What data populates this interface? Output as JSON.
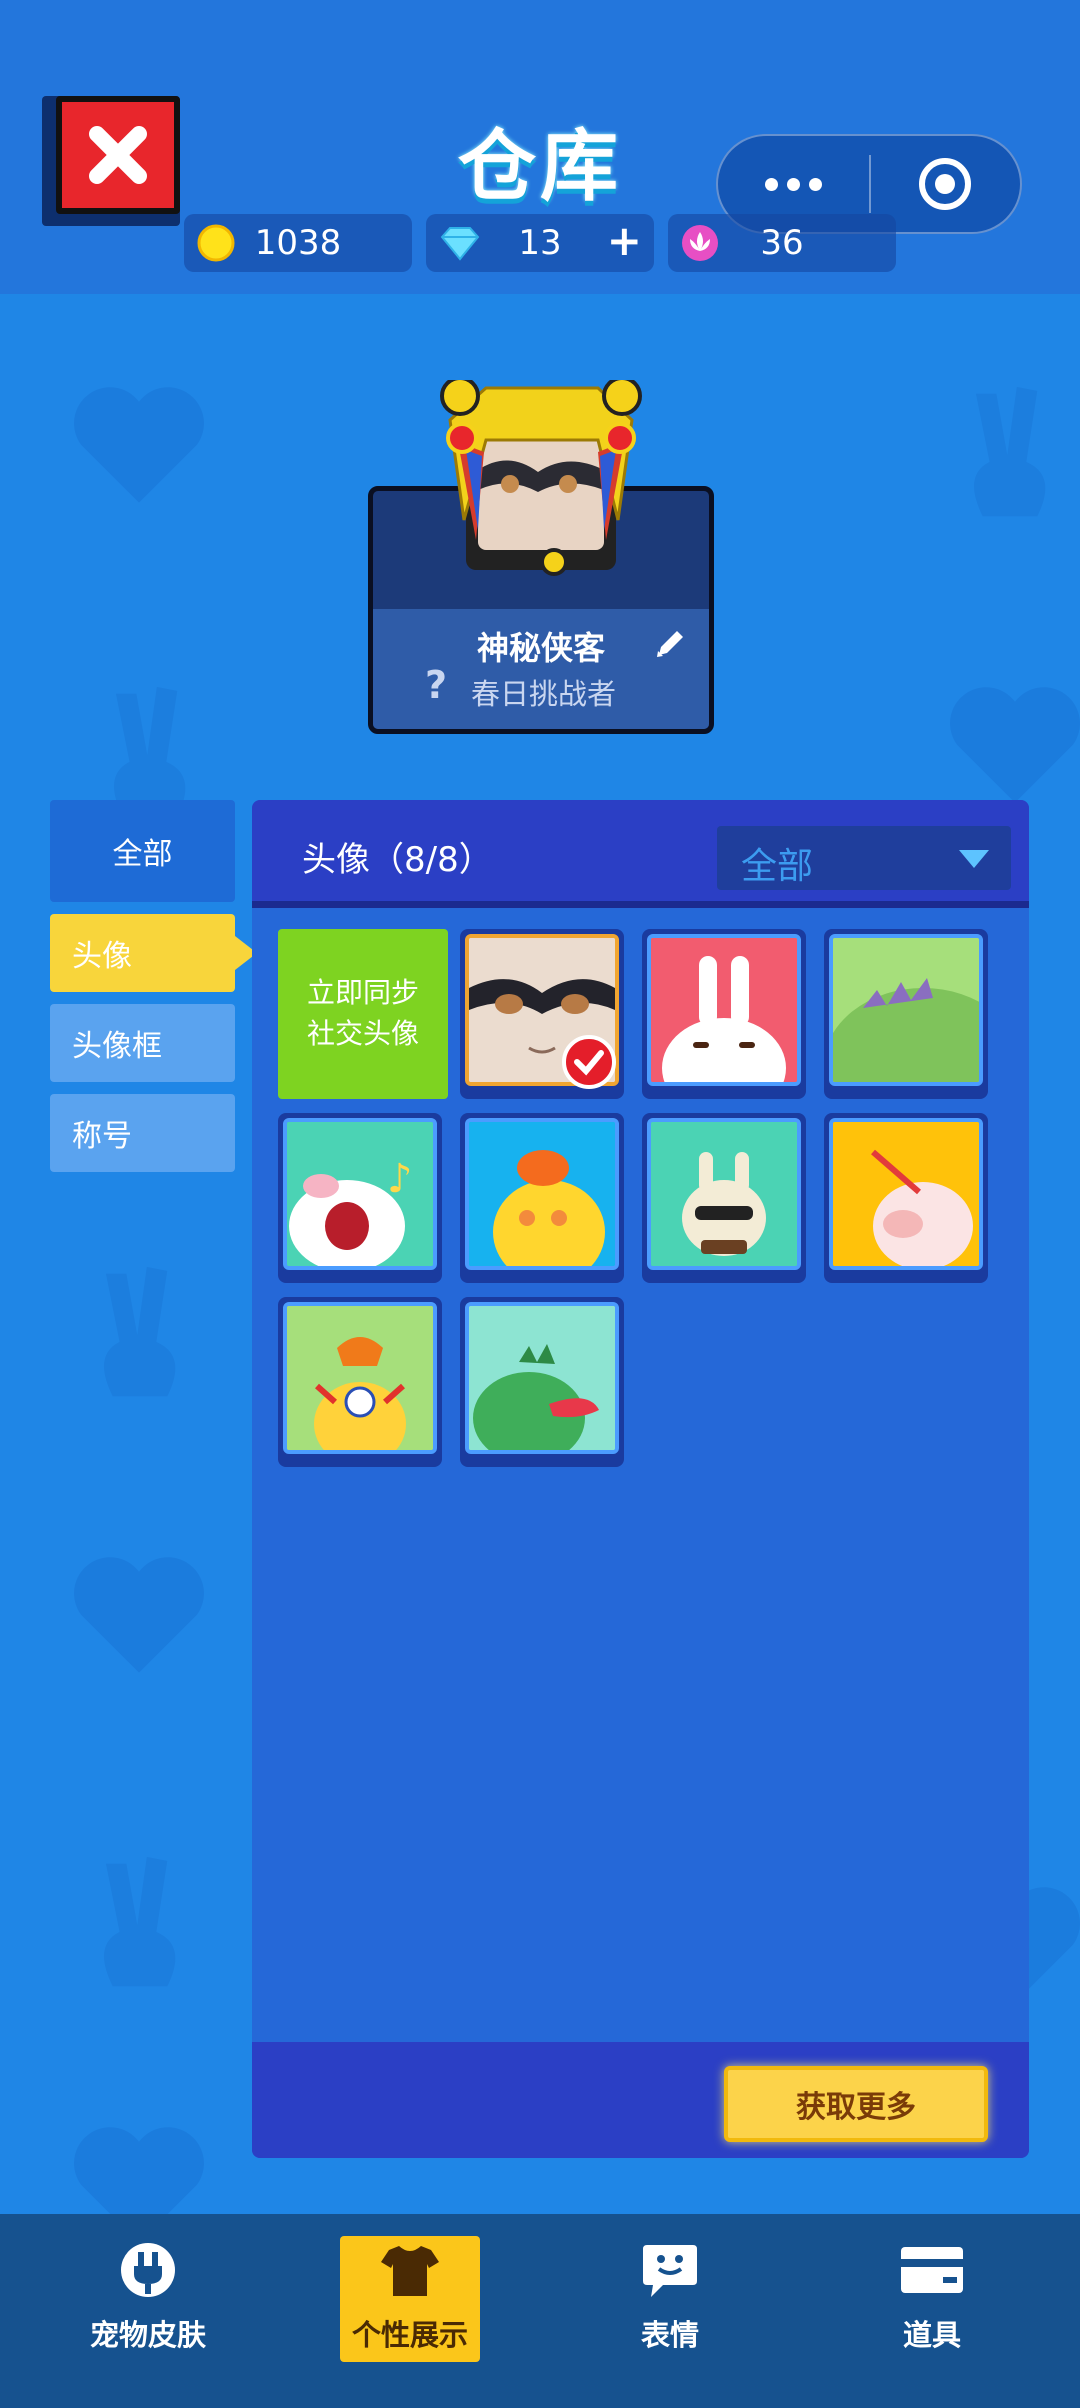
{
  "header": {
    "title": "仓库",
    "currencies": [
      {
        "icon": "gold-coin-icon",
        "value": "1038"
      },
      {
        "icon": "diamond-icon",
        "value": "13",
        "add": "+"
      },
      {
        "icon": "lotus-token-icon",
        "value": "36"
      }
    ]
  },
  "profile": {
    "name": "神秘侠客",
    "title_mark": "?",
    "title": "春日挑战者"
  },
  "tabs": {
    "all": "全部",
    "avatar": "头像",
    "frame": "头像框",
    "title": "称号"
  },
  "panel": {
    "title": "头像（8/8）",
    "filter": "全部",
    "sync_line1": "立即同步",
    "sync_line2": "社交头像",
    "more": "获取更多",
    "items": [
      {
        "name": "masked-hero-avatar",
        "selected": true
      },
      {
        "name": "white-rabbit-avatar"
      },
      {
        "name": "green-dino-back-avatar"
      },
      {
        "name": "singing-bunny-avatar"
      },
      {
        "name": "yellow-chick-avatar"
      },
      {
        "name": "sunglasses-bunny-avatar"
      },
      {
        "name": "pig-avatar"
      },
      {
        "name": "lion-avatar"
      },
      {
        "name": "green-dino-avatar"
      }
    ]
  },
  "nav": {
    "skins": "宠物皮肤",
    "showcase": "个性展示",
    "emotes": "表情",
    "items": "道具"
  },
  "colors": {
    "background": "#1f86e6",
    "accent": "#fbc61a",
    "sync_green": "#7ed321",
    "close_red": "#e8262c"
  }
}
